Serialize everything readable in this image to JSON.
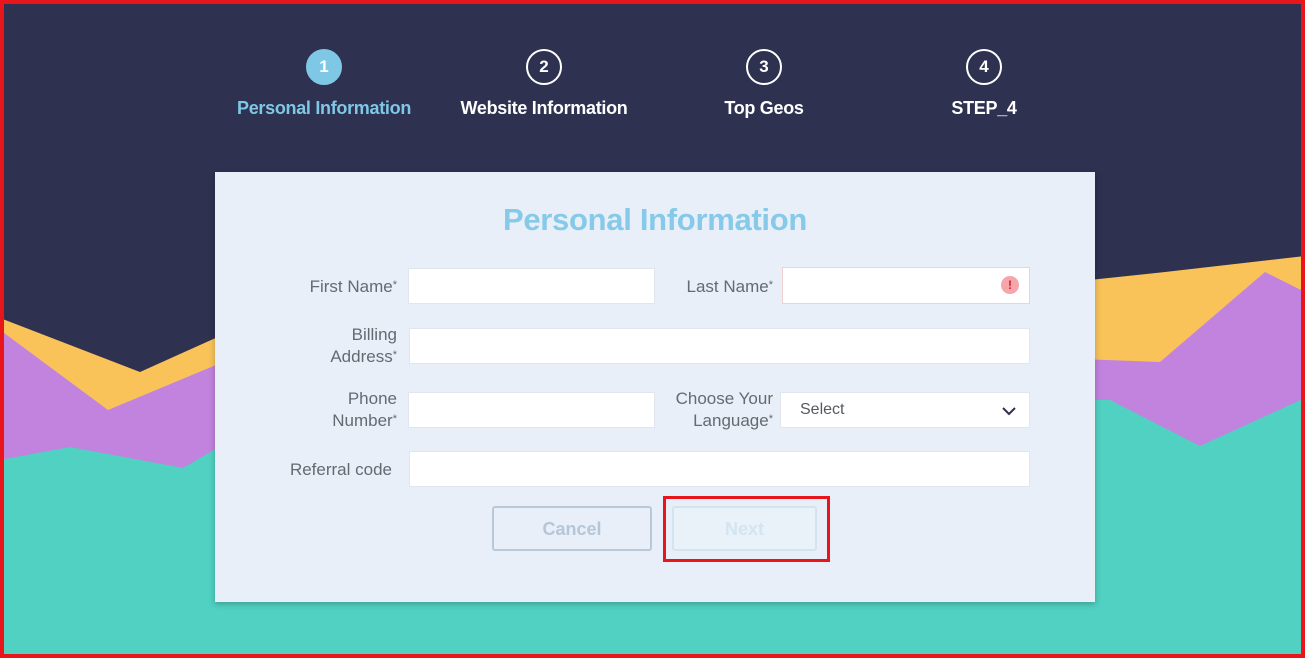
{
  "stepper": {
    "steps": [
      {
        "number": "1",
        "label": "Personal Information",
        "active": true
      },
      {
        "number": "2",
        "label": "Website Information",
        "active": false
      },
      {
        "number": "3",
        "label": "Top Geos",
        "active": false
      },
      {
        "number": "4",
        "label": "STEP_4",
        "active": false
      }
    ]
  },
  "form": {
    "title": "Personal Information",
    "first_name_label": "First Name",
    "last_name_label": "Last Name",
    "billing_label_line1": "Billing",
    "billing_label_line2": "Address",
    "phone_label_line1": "Phone",
    "phone_label_line2": "Number",
    "language_label_line1": "Choose Your",
    "language_label_line2": "Language",
    "referral_label": "Referral code",
    "required_mark": "*",
    "first_name_value": "",
    "last_name_value": "",
    "billing_value": "",
    "phone_value": "",
    "referral_value": "",
    "language_selected": "Select",
    "error_symbol": "!"
  },
  "buttons": {
    "cancel": "Cancel",
    "next": "Next"
  },
  "colors": {
    "background": "#2e3150",
    "accent": "#7ec8e6",
    "wave_yellow": "#f9c35a",
    "wave_purple": "#c283de",
    "wave_teal": "#50d1c2",
    "highlight": "#e8151b"
  }
}
